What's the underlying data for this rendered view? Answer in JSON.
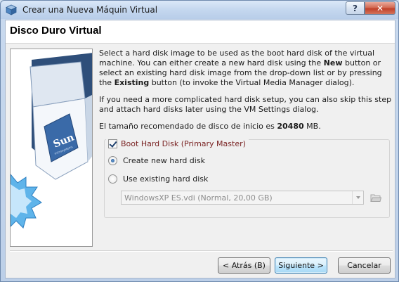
{
  "window": {
    "title": "Crear una Nueva Máquin Virtual",
    "help_label": "?",
    "close_label": "✕"
  },
  "header": {
    "title": "Disco Duro Virtual"
  },
  "logo": {
    "brand": "Sun",
    "tagline": "microsystems"
  },
  "description": {
    "p1_a": "Select a hard disk image to be used as the boot hard disk of the virtual machine. You can either create a new hard disk using the ",
    "p1_new": "New",
    "p1_b": " button or select an existing hard disk image from the drop-down list or by pressing the ",
    "p1_existing": "Existing",
    "p1_c": " button (to invoke the Virtual Media Manager dialog).",
    "p2": "If you need a more complicated hard disk setup, you can also skip this step and attach hard disks later using the VM Settings dialog.",
    "p3_a": "El tamaño recomendado de disco de inicio es ",
    "p3_size": "20480",
    "p3_b": " MB."
  },
  "boot_group": {
    "label": "Boot Hard Disk (Primary Master)",
    "checked": true,
    "options": [
      {
        "label": "Create new hard disk",
        "selected": true
      },
      {
        "label": "Use existing hard disk",
        "selected": false
      }
    ],
    "existing_disk": "WindowsXP ES.vdi (Normal, 20,00 GB)"
  },
  "buttons": {
    "back": "< Atrás (B)",
    "next": "Siguiente >",
    "cancel": "Cancelar"
  },
  "colors": {
    "legend_text": "#7a2323",
    "default_button_border": "#3c7fb1"
  }
}
